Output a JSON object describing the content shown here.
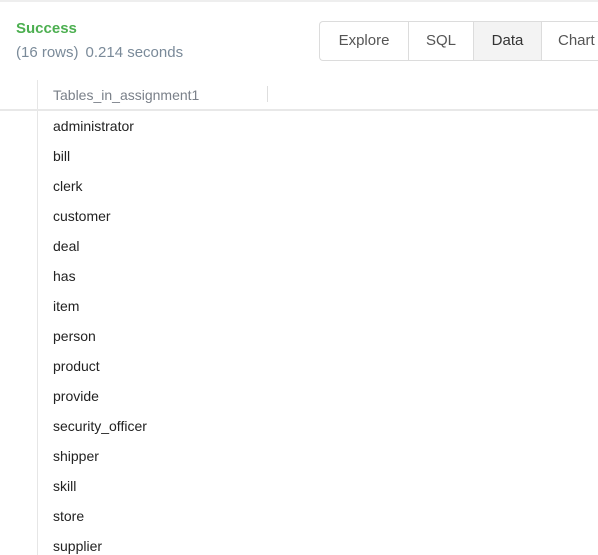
{
  "status": {
    "label": "Success",
    "row_count": "(16 rows)",
    "duration": "0.214 seconds"
  },
  "tabs": [
    {
      "label": "Explore",
      "active": false
    },
    {
      "label": "SQL",
      "active": false
    },
    {
      "label": "Data",
      "active": true
    },
    {
      "label": "Chart",
      "active": false
    }
  ],
  "table": {
    "columns": [
      "Tables_in_assignment1"
    ],
    "rows": [
      "administrator",
      "bill",
      "clerk",
      "customer",
      "deal",
      "has",
      "item",
      "person",
      "product",
      "provide",
      "security_officer",
      "shipper",
      "skill",
      "store",
      "supplier"
    ]
  },
  "colors": {
    "success": "#4caf50",
    "meta_text": "#7a8a99",
    "active_tab_bg": "#f3f3f3"
  }
}
